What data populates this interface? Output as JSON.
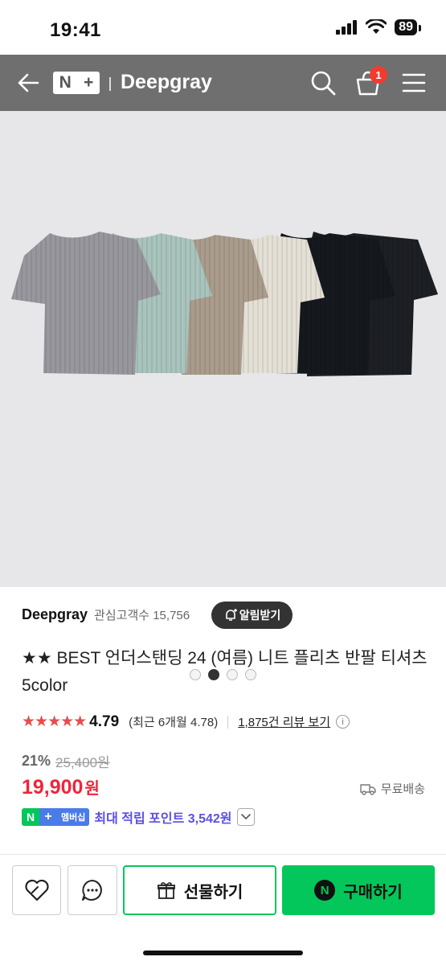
{
  "status_bar": {
    "time": "19:41",
    "battery": "89"
  },
  "header": {
    "logo_n": "N",
    "logo_plus": "+",
    "store_name": "Deepgray",
    "cart_count": "1"
  },
  "gallery": {
    "total_images": 4,
    "active_index": 1
  },
  "seller": {
    "name": "Deepgray",
    "followers": "관심고객수 15,756",
    "follow_label": "알림받기"
  },
  "product": {
    "title": "★★ BEST 언더스탠딩 24 (여름) 니트 플리츠 반팔 티셔츠 5color",
    "stars": "★★★★★",
    "score": "4.79",
    "recent": "(최근 6개월 4.78)",
    "review_link": "1,875건 리뷰 보기",
    "discount": "21%",
    "original_price": "25,400원",
    "price": "19,900",
    "price_unit": "원",
    "shipping": "무료배송",
    "membership_label": "멤버십",
    "points": "최대 적립 포인트 3,542원"
  },
  "bottom_bar": {
    "gift_label": "선물하기",
    "buy_label": "구매하기",
    "buy_icon": "N"
  },
  "colors": {
    "accent_green": "#03c75a",
    "price_red": "#f0243b",
    "points_purple": "#5b4ee8",
    "header_gray": "#6f6f6f"
  }
}
